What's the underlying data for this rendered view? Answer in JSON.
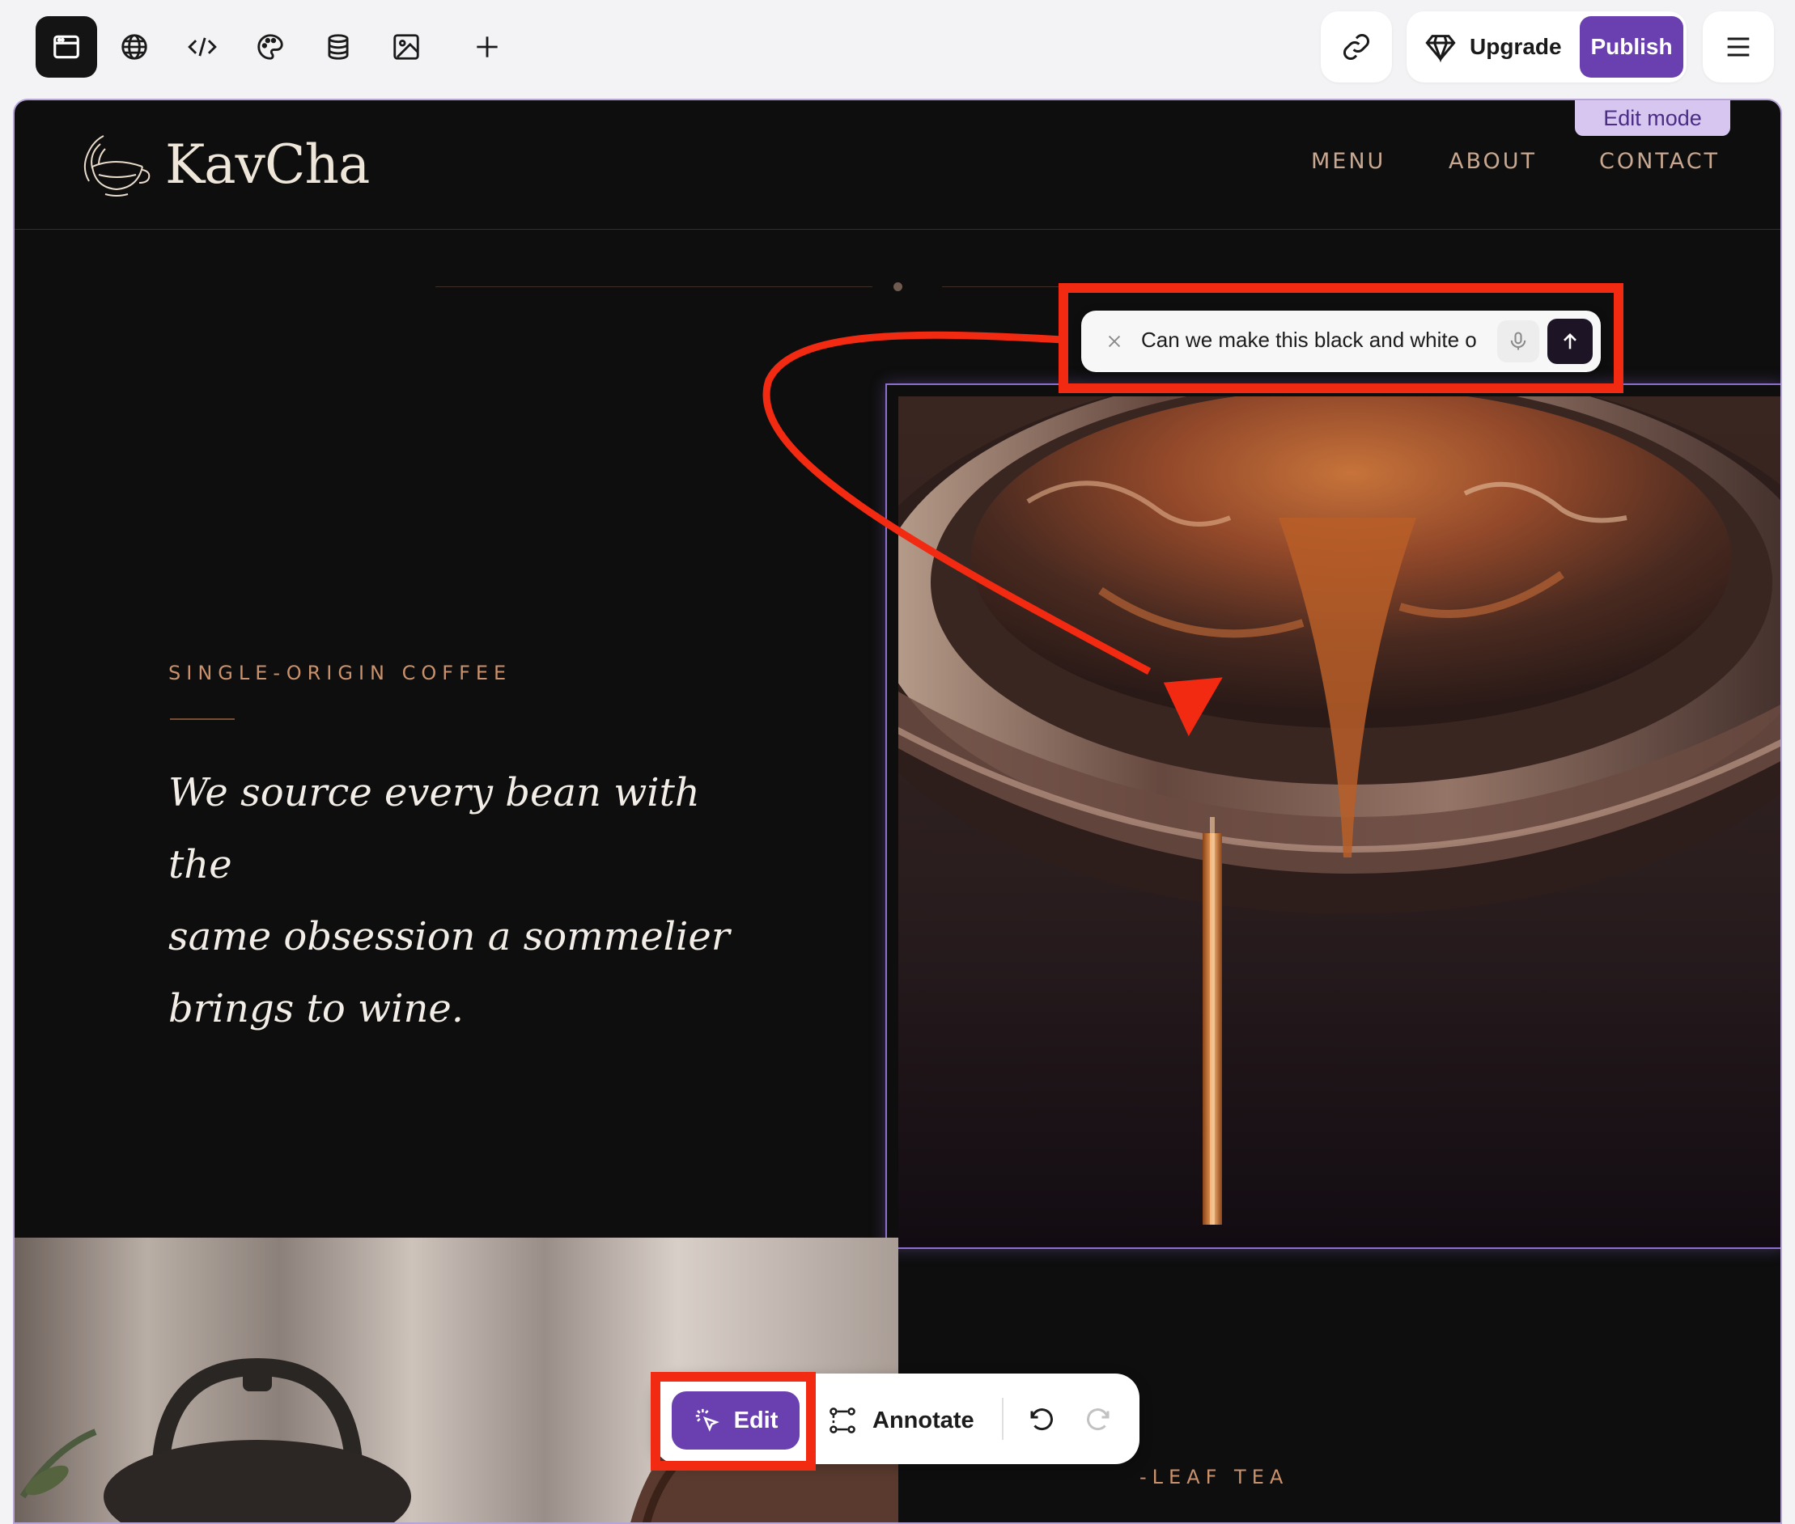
{
  "toolbar": {
    "tools": [
      "preview-icon",
      "globe-icon",
      "code-icon",
      "palette-icon",
      "database-icon",
      "image-icon",
      "plus-icon"
    ],
    "upgrade_label": "Upgrade",
    "publish_label": "Publish"
  },
  "canvas": {
    "edit_mode_label": "Edit mode"
  },
  "site": {
    "brand": "KavCha",
    "nav": [
      "MENU",
      "ABOUT",
      "CONTACT"
    ],
    "eyebrow": "SINGLE-ORIGIN COFFEE",
    "quote_lines": [
      "We source every bean with the",
      "same obsession a sommelier",
      "brings to wine."
    ],
    "tea_eyebrow": "-LEAF TEA"
  },
  "prompt": {
    "text": "Can we make this black and white o"
  },
  "floating_toolbar": {
    "edit_label": "Edit",
    "annotate_label": "Annotate"
  },
  "colors": {
    "accent": "#6a3fb0",
    "annotation": "#f22a12",
    "site_bg": "#0e0e0e",
    "eyebrow": "#c9916c",
    "nav": "#c9a891"
  }
}
